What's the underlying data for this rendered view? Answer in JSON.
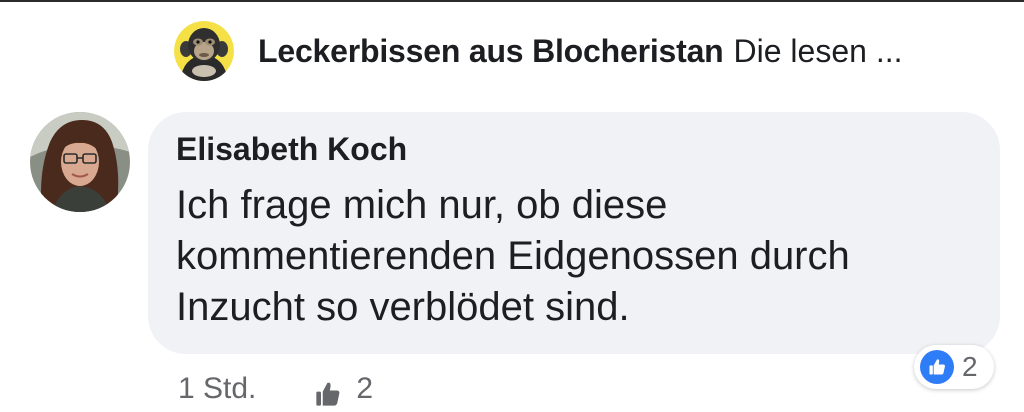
{
  "post": {
    "group_name": "Leckerbissen aus Blocheristan",
    "snippet": "Die lesen ..."
  },
  "comment": {
    "author": "Elisabeth Koch",
    "text_lines": [
      "Ich frage mich nur, ob diese",
      "kommentierenden Eidgenossen durch",
      "Inzucht so verblödet sind."
    ],
    "reaction_count": "2",
    "reaction_icon": "thumbs-up-icon",
    "timestamp": "1 Std.",
    "like_count": "2"
  },
  "colors": {
    "bubble": "#f0f2f5",
    "text": "#1c1e21",
    "secondary_text": "#65676b",
    "like_blue": "#2e7cf6",
    "group_avatar_bg": "#f5e146"
  }
}
